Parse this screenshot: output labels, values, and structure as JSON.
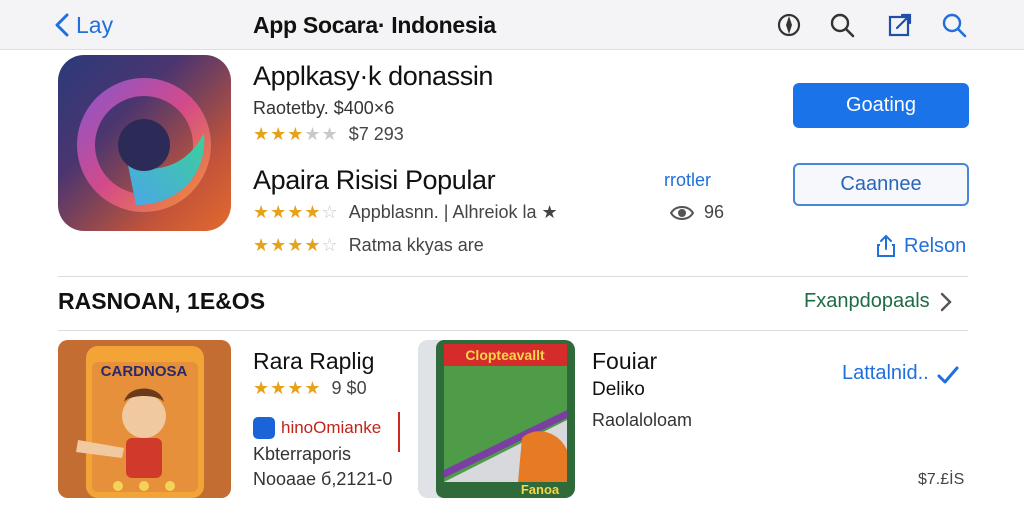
{
  "nav": {
    "back_label": "Lay",
    "title": "App Socara· Indonesia",
    "icons": [
      "compass-icon",
      "search-icon",
      "share-icon",
      "search-icon"
    ]
  },
  "featured": {
    "name": "Applkasy·k donassin",
    "meta": "Raotetby. $400×6",
    "rating_stars": 2.5,
    "rating_text": "$7 293",
    "headline": "Apaira Risisi Popular",
    "tag": "rrotler",
    "row1_stars": 4,
    "row1_text": "Appblasnn. | Alhreiok   la ★",
    "row1_count": "96",
    "row2_stars": 4,
    "row2_text": "Ratma kkyas are",
    "primary_button": "Goating",
    "secondary_button": "Caannee",
    "share_label": "Relson"
  },
  "section": {
    "title": "RASNOAN, 1E&OS",
    "see_all": "Fxanpdopaals"
  },
  "cards": [
    {
      "title": "Rara Raplig",
      "stars": 4,
      "rating_text": "9 $0",
      "developer": "hinoOmianke",
      "category": "Kbterraporis",
      "note": "Nooaae б,2121-0",
      "image_text": "CARDNOSA"
    },
    {
      "title": "Fouiar",
      "subtitle": "Deliko",
      "note": "Raolaloloam",
      "image_text": "Clopteavallt",
      "image_footer": "Fanoa"
    }
  ],
  "latest_label": "Lattalnid..",
  "price": "$7.£İS",
  "colors": {
    "accent": "#1a73e8",
    "star": "#e6a21b",
    "see_all": "#1e6b45",
    "badge": "#c0241a"
  }
}
